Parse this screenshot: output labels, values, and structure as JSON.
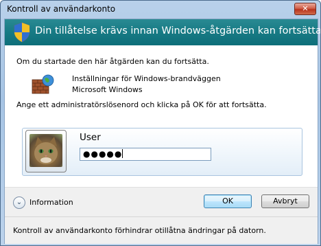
{
  "window": {
    "title": "Kontroll av användarkonto",
    "close_label": "✕"
  },
  "banner": {
    "text": "Din tillåtelse krävs innan Windows-åtgärden kan fortsätta",
    "icon": "shield-icon"
  },
  "body": {
    "intro": "Om du startade den här åtgärden kan du fortsätta.",
    "program_name": "Inställningar för Windows-brandväggen",
    "publisher": "Microsoft Windows",
    "instruction": "Ange ett administratörslösenord och klicka på OK för att fortsätta."
  },
  "credentials": {
    "username": "User",
    "password_mask": "●●●●●"
  },
  "footer": {
    "info_label": "Information",
    "ok_label": "OK",
    "cancel_label": "Avbryt",
    "note": "Kontroll av användarkonto förhindrar otillåtna ändringar på datorn."
  }
}
